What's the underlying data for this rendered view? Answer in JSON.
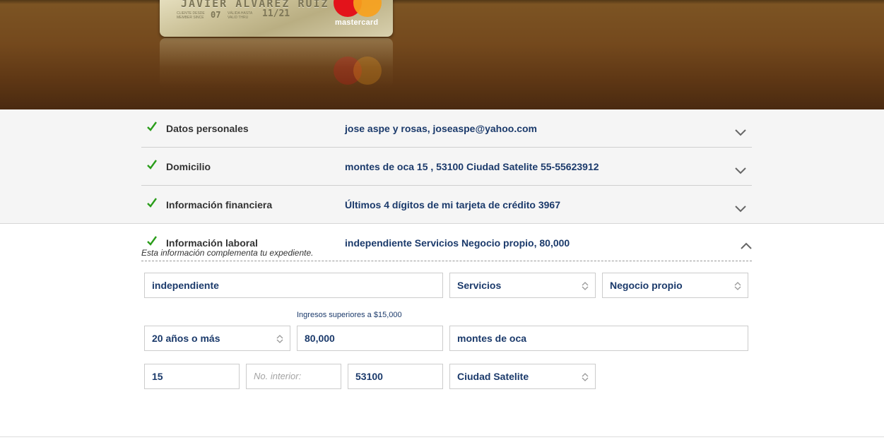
{
  "hero": {
    "card_name": "JAVIER ALVAREZ RUIZ",
    "card_since_label": "CLIENTE DESDE MEMBER SINCE",
    "card_since": "07",
    "card_valid_label": "VÁLIDA HASTA VALID THRU",
    "card_expiry": "11/21",
    "brand": "mastercard"
  },
  "sections": [
    {
      "title": "Datos personales",
      "summary": "jose aspe y rosas, joseaspe@yahoo.com",
      "status": "complete"
    },
    {
      "title": "Domicilio",
      "summary": "montes de oca 15 , 53100 Ciudad Satelite 55-55623912",
      "status": "complete"
    },
    {
      "title": "Información financiera",
      "summary": "Últimos 4 dígitos de mi tarjeta de crédito 3967",
      "status": "complete"
    },
    {
      "title": "Información laboral",
      "summary": "independiente Servicios Negocio propio, 80,000",
      "status": "complete",
      "subtitle": "Esta información complementa tu expediente."
    }
  ],
  "form": {
    "employment_type": "independiente",
    "sector": "Servicios",
    "occupation": "Negocio propio",
    "seniority": "20 años o más",
    "income_hint": "Ingresos superiores a $15,000",
    "income": "80,000",
    "street": "montes de oca",
    "ext_number": "15",
    "int_number_placeholder": "No. interior:",
    "zip": "53100",
    "colony": "Ciudad Satelite"
  },
  "colors": {
    "accent_navy": "#1b3a6b",
    "check_green": "#2a9d1a",
    "hero_brown": "#74491d"
  }
}
